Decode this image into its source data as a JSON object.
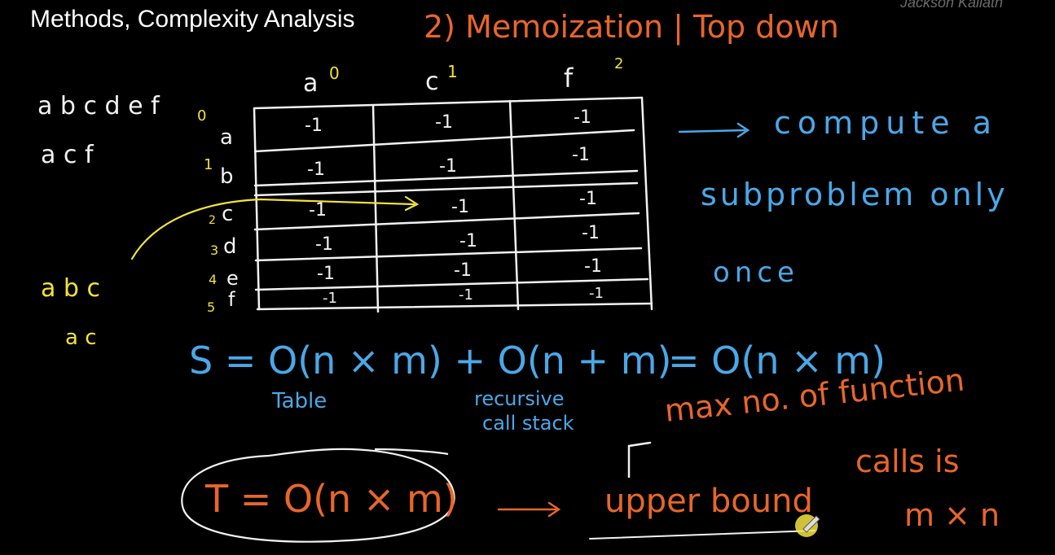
{
  "header": {
    "title": "Methods, Complexity Analysis",
    "author": "Jackson Kallath"
  },
  "heading": {
    "method": "2) Memoization | Top down"
  },
  "strings": {
    "s1": "a b c d e f",
    "s2": "a c f",
    "ex1": "a b c",
    "ex2": "a c"
  },
  "table": {
    "col_headers": [
      "a",
      "c",
      "f"
    ],
    "col_indices": [
      "0",
      "1",
      "2"
    ],
    "row_labels": [
      "a",
      "b",
      "c",
      "d",
      "e",
      "f"
    ],
    "row_indices": [
      "0",
      "1",
      "2",
      "3",
      "4",
      "5"
    ],
    "cell_value": "-1"
  },
  "note": {
    "line1": "compute a",
    "line2": "subproblem only",
    "line3": "once"
  },
  "space": {
    "formula": "S = O(n × m) + O(n + m)",
    "result": "= O(n × m)",
    "label_table": "Table",
    "label_recursive_1": "recursive",
    "label_recursive_2": "call stack"
  },
  "time": {
    "formula": "T = O(n × m)",
    "arrow_label": "upper bound",
    "reason_1": "max no. of function",
    "reason_2": "calls is",
    "reason_3": "m × n"
  },
  "colors": {
    "background": "#000000",
    "white_ink": "#f2f2f2",
    "yellow_ink": "#f2e33a",
    "orange_ink": "#e8662a",
    "blue_ink": "#4aa8e8"
  }
}
